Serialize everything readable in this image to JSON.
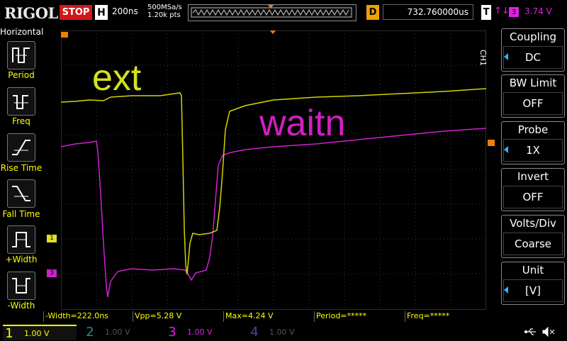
{
  "header": {
    "brand": "RIGOL",
    "run_state": "STOP",
    "h_label": "H",
    "timebase": "200ns",
    "sample_rate": "500MSa/s",
    "points": "1.20k pts",
    "d_label": "D",
    "delay": "732.760000us",
    "t_label": "T",
    "trigger_slope": "↑↓",
    "trigger_source": "3",
    "trigger_level": "3.74 V"
  },
  "left_panel": {
    "title": "Horizontal",
    "items": [
      {
        "label": "Period",
        "icon": "period-icon"
      },
      {
        "label": "Freq",
        "icon": "freq-icon"
      },
      {
        "label": "Rise Time",
        "icon": "rise-time-icon"
      },
      {
        "label": "Fall Time",
        "icon": "fall-time-icon"
      },
      {
        "label": "+Width",
        "icon": "pos-width-icon"
      },
      {
        "label": "-Width",
        "icon": "neg-width-icon"
      }
    ]
  },
  "waveform": {
    "annotations": [
      "ext",
      "waitn"
    ],
    "ch1_marker": "1",
    "ch3_marker": "3",
    "colors": {
      "ch1": "#e0e020",
      "ch3": "#d020d0",
      "trigger": "#f08000",
      "grid": "#3a3a3a"
    }
  },
  "measurements": [
    {
      "text": "-Width=222.0ns"
    },
    {
      "text": "Vpp=5.28 V"
    },
    {
      "text": "Max=4.24 V"
    },
    {
      "text": "Period=*****"
    },
    {
      "text": "Freq=*****"
    }
  ],
  "channels": [
    {
      "num": "1",
      "value": "1.00 V",
      "color": "#ffff00",
      "active": true
    },
    {
      "num": "2",
      "value": "1.00 V",
      "color": "#2a8a8a",
      "active": false
    },
    {
      "num": "3",
      "value": "1.00 V",
      "color": "#e020e0",
      "active": true
    },
    {
      "num": "4",
      "value": "1.00 V",
      "color": "#3a4aaa",
      "active": false
    }
  ],
  "right_panel": {
    "channel_tag": "CH1",
    "items": [
      {
        "title": "Coupling",
        "value": "DC"
      },
      {
        "title": "BW Limit",
        "value": "OFF"
      },
      {
        "title": "Probe",
        "value": "1X"
      },
      {
        "title": "Invert",
        "value": "OFF"
      },
      {
        "title": "Volts/Div",
        "value": "Coarse"
      },
      {
        "title": "Unit",
        "value": "[V]"
      }
    ]
  }
}
